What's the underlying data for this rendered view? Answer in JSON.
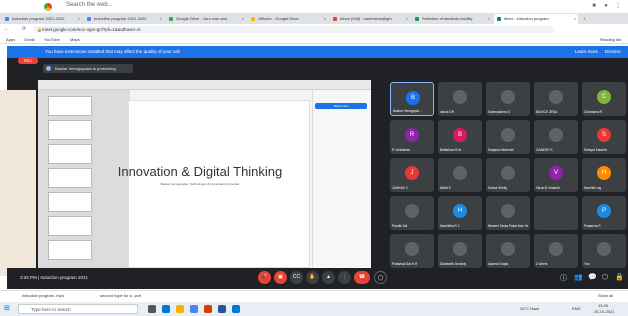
{
  "browser": {
    "search_placeholder": "Search the web...",
    "tabs": [
      {
        "label": "Induction program 2021-2022",
        "color": "#4285f4"
      },
      {
        "label": "Induction program 2021-2022",
        "color": "#4285f4"
      },
      {
        "label": "Google Drive - Your own stor",
        "color": "#34a853"
      },
      {
        "label": "OfficeIn - Google Drive",
        "color": "#fbbc05"
      },
      {
        "label": "Inbox (948) - sanfrancis@gm",
        "color": "#ea4335"
      },
      {
        "label": "Selection of students bacility",
        "color": "#0f9d58"
      },
      {
        "label": "Meet - Induction program",
        "color": "#00897b",
        "active": true
      }
    ],
    "url": "meet.google.com/noc-ogrx-gcf?pli=1&authuser=0",
    "bookmarks": [
      "Apps",
      "Gmail",
      "YouTube",
      "Maps"
    ],
    "reading_list": "Reading list"
  },
  "meet": {
    "warning": "You have extensions installed that may affect the quality of your call",
    "learn_more": "Learn more",
    "dismiss": "Dismiss",
    "rec_label": "REC",
    "presenting": "Baskar Venugopalan is presenting",
    "slide_title": "Innovation & Digital Thinking",
    "slide_subtitle": "Baskar Venugopalan, Technologist & Consultant & Founder",
    "screen_action": "Share Now",
    "time_label": "3:26 PM | Induction program 2021",
    "participants": [
      {
        "name": "Baskar Venugopal...",
        "initial": "B",
        "color": "#1a73e8",
        "selected": true
      },
      {
        "name": "ashok DR",
        "initial": "",
        "color": "#5f6368"
      },
      {
        "name": "Swarnpalrma G",
        "initial": "",
        "color": "#5f6368"
      },
      {
        "name": "BUNICE JENA",
        "initial": "",
        "color": "#5f6368"
      },
      {
        "name": "Chandana R",
        "initial": "C",
        "color": "#7cb342"
      },
      {
        "name": "R Venkatesh",
        "initial": "R",
        "color": "#8e24aa"
      },
      {
        "name": "Bettiahme B M",
        "initial": "B",
        "color": "#d81b60"
      },
      {
        "name": "Sanjana Hiremath",
        "initial": "",
        "color": "#5f6368"
      },
      {
        "name": "GANESH S",
        "initial": "",
        "color": "#5f6368"
      },
      {
        "name": "Shimpa Karanth",
        "initial": "S",
        "color": "#e53935"
      },
      {
        "name": "JANHAVI V",
        "initial": "J",
        "color": "#e53935"
      },
      {
        "name": "Nikhil S",
        "initial": "",
        "color": "#5f6368"
      },
      {
        "name": "Sneha Shetty",
        "initial": "",
        "color": "#5f6368"
      },
      {
        "name": "Varun.B Vedanth",
        "initial": "V",
        "color": "#8e24aa"
      },
      {
        "name": "Harshith mg",
        "initial": "H",
        "color": "#fb8c00"
      },
      {
        "name": "Parolik Sai",
        "initial": "",
        "color": "#5f6368"
      },
      {
        "name": "Harshitha R J",
        "initial": "H",
        "color": "#1e88e5"
      },
      {
        "name": "Nevemi Tanas Passi from the call",
        "initial": "",
        "color": "#5f6368"
      },
      {
        "name": "",
        "initial": "",
        "color": "#3c4043"
      },
      {
        "name": "Prasanna S",
        "initial": "P",
        "color": "#1e88e5"
      },
      {
        "name": "Prakshak Sai N R",
        "initial": "",
        "color": "#5f6368"
      },
      {
        "name": "Gladearth Devaraj",
        "initial": "",
        "color": "#5f6368"
      },
      {
        "name": "Ayansh Gupta",
        "initial": "",
        "color": "#5f6368"
      },
      {
        "name": "2 others",
        "initial": "",
        "color": "#5f6368"
      },
      {
        "name": "You",
        "initial": "",
        "color": "#5f6368"
      }
    ]
  },
  "downloads": [
    {
      "label": "induction program..mp4"
    },
    {
      "label": "second hype for a ..pdf"
    }
  ],
  "downloads_show_all": "Show all",
  "taskbar": {
    "search_placeholder": "Type here to search",
    "weather": "26°C Haze",
    "lang": "ENG",
    "time": "15:26",
    "date": "25-10-2021"
  }
}
